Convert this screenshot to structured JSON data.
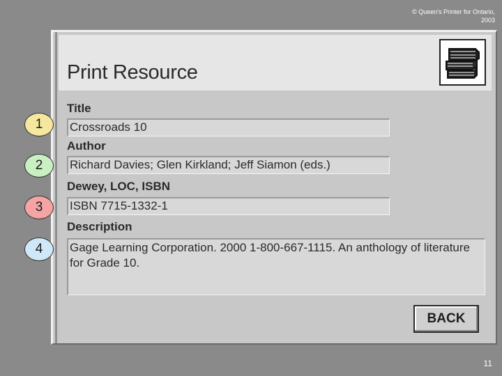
{
  "slide": {
    "copyright": "© Queen's Printer for Ontario, 2003",
    "page_number": "11"
  },
  "window": {
    "title": "Print Resource",
    "icon": "books-icon",
    "back_label": "BACK"
  },
  "fields": [
    {
      "label": "Title",
      "value": "Crossroads 10"
    },
    {
      "label": "Author",
      "value": "Richard Davies; Glen Kirkland; Jeff Siamon  (eds.)"
    },
    {
      "label": "Dewey, LOC, ISBN",
      "value": "ISBN 7715-1332-1"
    },
    {
      "label": "Description",
      "value": "Gage Learning Corporation. 2000  1-800-667-1115. An anthology of literature for Grade 10."
    }
  ],
  "callouts": [
    {
      "number": "1",
      "color": "#f5e79e"
    },
    {
      "number": "2",
      "color": "#c8f0c0"
    },
    {
      "number": "3",
      "color": "#f4a4a4"
    },
    {
      "number": "4",
      "color": "#cfe8f7"
    }
  ]
}
